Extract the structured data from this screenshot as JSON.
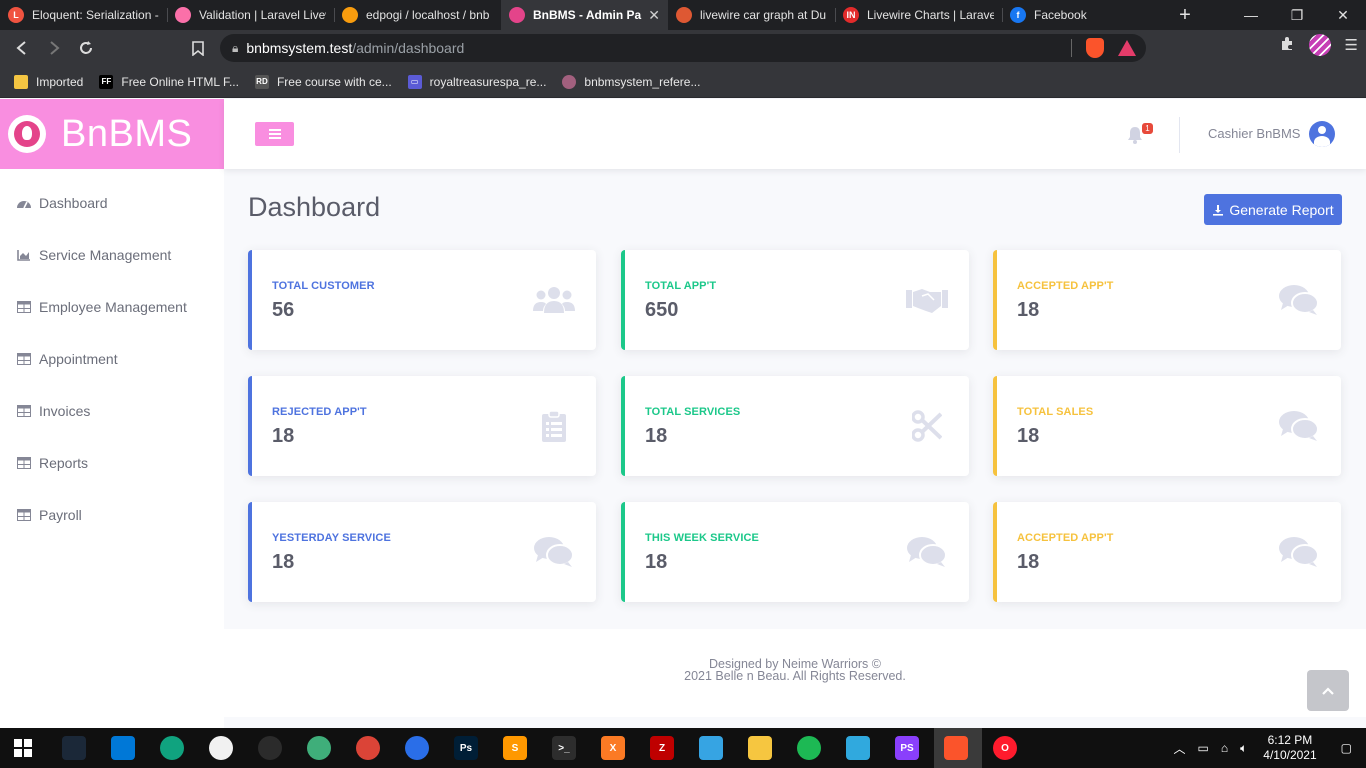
{
  "browser": {
    "tabs": [
      {
        "title": "Eloquent: Serialization -",
        "color": "#f05340",
        "glyph": "L",
        "active": false
      },
      {
        "title": "Validation | Laravel Livew",
        "color": "#fb70a9",
        "glyph": "",
        "active": false
      },
      {
        "title": "edpogi / localhost / bnb",
        "color": "#f89c0e",
        "glyph": "",
        "active": false
      },
      {
        "title": "BnBMS - Admin Pa",
        "color": "#e4448a",
        "glyph": "",
        "active": true
      },
      {
        "title": "livewire car graph at Du",
        "color": "#de5833",
        "glyph": "",
        "active": false
      },
      {
        "title": "Livewire Charts | Laravel",
        "color": "#e22b2b",
        "glyph": "IN",
        "active": false
      },
      {
        "title": "Facebook",
        "color": "#1877f2",
        "glyph": "f",
        "active": false
      }
    ],
    "url_host": "bnbmsystem.test",
    "url_path": "/admin/dashboard",
    "bookmarks": [
      {
        "label": "Imported",
        "color": "#f4c542",
        "glyph": ""
      },
      {
        "label": "Free Online HTML F...",
        "color": "#000000",
        "glyph": "FF"
      },
      {
        "label": "Free course with ce...",
        "color": "#555555",
        "glyph": "RD"
      },
      {
        "label": "royaltreasurespa_re...",
        "color": "#5b5bd6",
        "glyph": "▭"
      },
      {
        "label": "bnbmsystem_refere...",
        "color": "#a2607e",
        "glyph": ""
      }
    ]
  },
  "app": {
    "brand": "BnBMS",
    "sidebar": [
      {
        "label": "Dashboard",
        "icon": "tachometer-icon"
      },
      {
        "label": "Service Management",
        "icon": "chart-area-icon"
      },
      {
        "label": "Employee Management",
        "icon": "table-icon"
      },
      {
        "label": "Appointment",
        "icon": "table-icon"
      },
      {
        "label": "Invoices",
        "icon": "table-icon"
      },
      {
        "label": "Reports",
        "icon": "table-icon"
      },
      {
        "label": "Payroll",
        "icon": "table-icon"
      }
    ],
    "topbar": {
      "notification_count": "1",
      "user_name": "Cashier BnBMS"
    },
    "page_title": "Dashboard",
    "report_button": "Generate Report",
    "cards": [
      {
        "label": "TOTAL CUSTOMER",
        "value": "56",
        "variant": "primary",
        "icon": "users-icon"
      },
      {
        "label": "TOTAL APP'T",
        "value": "650",
        "variant": "success",
        "icon": "handshake-icon"
      },
      {
        "label": "ACCEPTED APP'T",
        "value": "18",
        "variant": "warning",
        "icon": "comments-icon"
      },
      {
        "label": "REJECTED APP'T",
        "value": "18",
        "variant": "primary",
        "icon": "clipboard-list-icon"
      },
      {
        "label": "TOTAL SERVICES",
        "value": "18",
        "variant": "success",
        "icon": "scissors-icon"
      },
      {
        "label": "TOTAL SALES",
        "value": "18",
        "variant": "warning",
        "icon": "comments-icon"
      },
      {
        "label": "YESTERDAY SERVICE",
        "value": "18",
        "variant": "primary",
        "icon": "comments-icon"
      },
      {
        "label": "THIS WEEK SERVICE",
        "value": "18",
        "variant": "success",
        "icon": "comments-icon"
      },
      {
        "label": "ACCEPTED APP'T",
        "value": "18",
        "variant": "warning",
        "icon": "comments-icon"
      }
    ],
    "footer": {
      "line1": "Designed by Neime Warriors ©",
      "line2": "2021 Belle n Beau. All Rights Reserved."
    }
  },
  "taskbar": {
    "apps": [
      {
        "name": "steam-icon",
        "color": "#1b2838",
        "glyph": ""
      },
      {
        "name": "vscode-icon",
        "color": "#0078d7",
        "glyph": ""
      },
      {
        "name": "chatgpt-icon",
        "color": "#10a37f",
        "glyph": ""
      },
      {
        "name": "emoji-icon",
        "color": "#f1f1f1",
        "glyph": ""
      },
      {
        "name": "obs-icon",
        "color": "#2b2b2b",
        "glyph": ""
      },
      {
        "name": "git-icon",
        "color": "#3fae7a",
        "glyph": ""
      },
      {
        "name": "chrome-icon",
        "color": "#db4437",
        "glyph": ""
      },
      {
        "name": "firefox-icon",
        "color": "#2a6ee8",
        "glyph": ""
      },
      {
        "name": "photoshop-icon",
        "color": "#001e36",
        "glyph": "Ps"
      },
      {
        "name": "sublime-icon",
        "color": "#ff9800",
        "glyph": "S"
      },
      {
        "name": "terminal-icon",
        "color": "#2d2d2d",
        "glyph": ">_"
      },
      {
        "name": "xampp-icon",
        "color": "#fb7a24",
        "glyph": "X"
      },
      {
        "name": "filezilla-icon",
        "color": "#bf0000",
        "glyph": "Z"
      },
      {
        "name": "app-icon",
        "color": "#36a4e3",
        "glyph": ""
      },
      {
        "name": "file-explorer-icon",
        "color": "#f6c640",
        "glyph": ""
      },
      {
        "name": "spotify-icon",
        "color": "#1db954",
        "glyph": ""
      },
      {
        "name": "teams-icon",
        "color": "#30a9de",
        "glyph": ""
      },
      {
        "name": "phpstorm-icon",
        "color": "#8a3ffc",
        "glyph": "PS"
      },
      {
        "name": "brave-icon",
        "color": "#fb542b",
        "glyph": ""
      },
      {
        "name": "opera-icon",
        "color": "#ff1b2d",
        "glyph": "O"
      }
    ],
    "time": "6:12 PM",
    "date": "4/10/2021"
  }
}
